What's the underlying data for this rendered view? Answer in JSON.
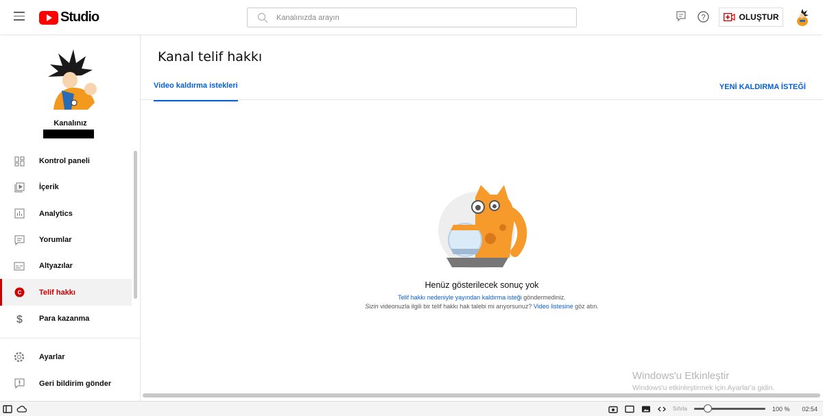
{
  "header": {
    "logo_text": "Studio",
    "search_placeholder": "Kanalınızda arayın",
    "create_label": "OLUŞTUR",
    "icons": [
      "menu-icon",
      "search-icon",
      "feedback-icon",
      "help-icon",
      "create-video-icon"
    ]
  },
  "sidebar": {
    "channel_label": "Kanalınız",
    "items": [
      {
        "label": "Kontrol paneli",
        "icon": "dashboard-icon"
      },
      {
        "label": "İçerik",
        "icon": "content-icon"
      },
      {
        "label": "Analytics",
        "icon": "analytics-icon"
      },
      {
        "label": "Yorumlar",
        "icon": "comments-icon"
      },
      {
        "label": "Altyazılar",
        "icon": "subtitles-icon"
      },
      {
        "label": "Telif hakkı",
        "icon": "copyright-icon",
        "active": true
      },
      {
        "label": "Para kazanma",
        "icon": "dollar-icon"
      }
    ],
    "bottom_items": [
      {
        "label": "Ayarlar",
        "icon": "gear-icon"
      },
      {
        "label": "Geri bildirim gönder",
        "icon": "feedback-icon"
      }
    ]
  },
  "main": {
    "title": "Kanal telif hakkı",
    "tab": "Video kaldırma istekleri",
    "new_request": "YENİ KALDIRMA İSTEĞİ",
    "empty": {
      "heading": "Henüz gösterilecek sonuç yok",
      "link1": "Telif hakkı nedeniyle yayından kaldırma isteği",
      "text1": " göndermediniz.",
      "italic": "Sizin",
      "text2": " videonuzla ilgili bir telif hakkı hak talebi mi arıyorsunuz? ",
      "link2": "Video listesine",
      "text3": " göz atın."
    }
  },
  "watermark": {
    "title": "Windows'u Etkinleştir",
    "subtitle": "Windows'u etkinleştirmek için Ayarlar'a gidin."
  },
  "statusbar": {
    "reset": "Sıfırla",
    "zoom": "100 %",
    "zoom_percent": 100,
    "time": "02:54"
  },
  "colors": {
    "accent": "#065fd4",
    "active": "#cc0000",
    "brand": "#ff0000"
  }
}
